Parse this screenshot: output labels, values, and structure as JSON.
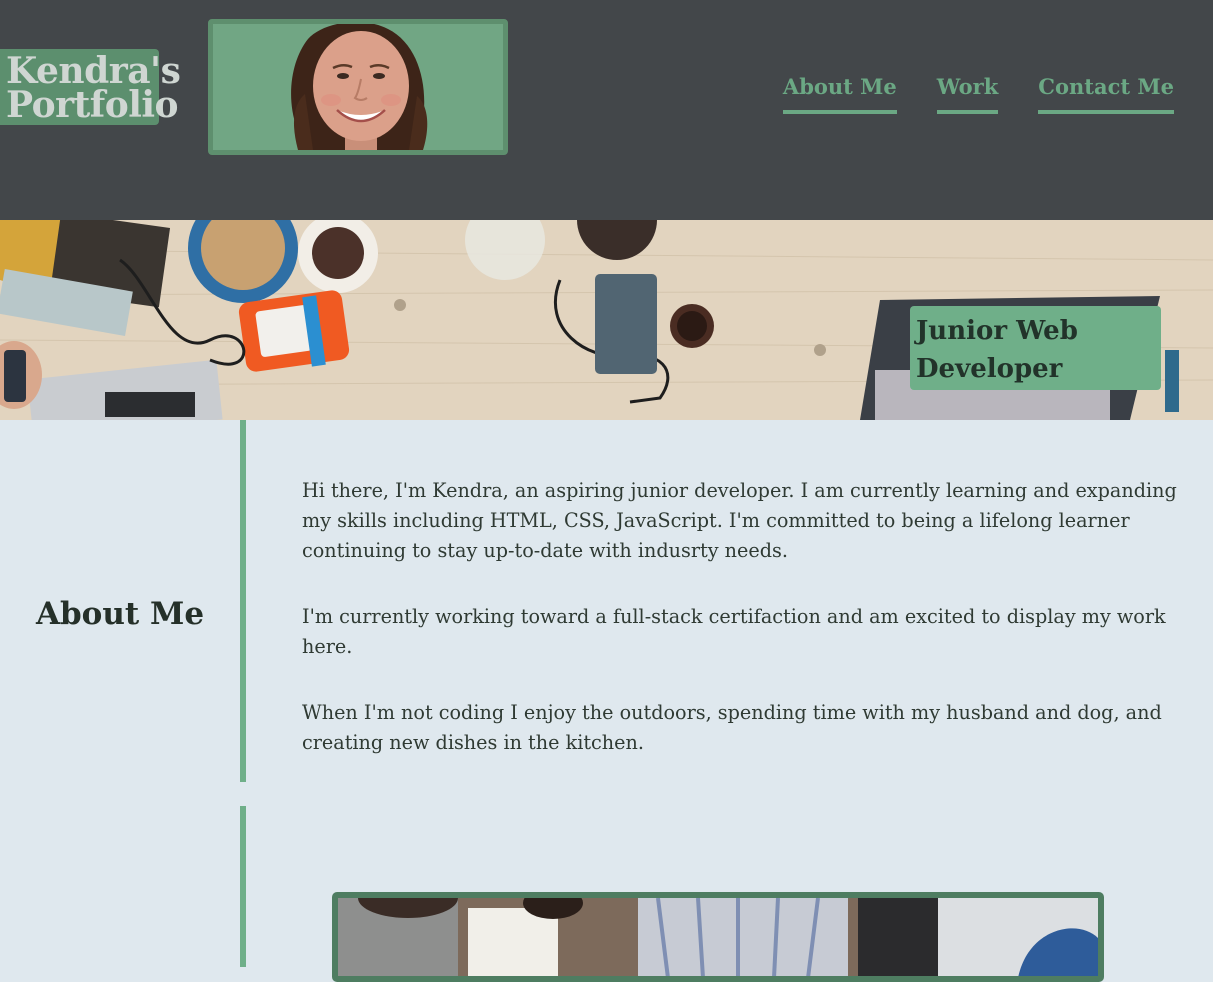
{
  "header": {
    "logo_line1": "Kendra's",
    "logo_line2": "Portfolio",
    "nav": [
      "About Me",
      "Work",
      "Contact Me"
    ]
  },
  "hero": {
    "tagline_line1": "Junior Web",
    "tagline_line2": "Developer"
  },
  "about": {
    "title": "About Me",
    "paragraphs": [
      "Hi there, I'm Kendra, an aspiring junior developer. I am currently learning and expanding my skills including HTML, CSS, JavaScript. I'm committed to being a lifelong learner continuing to stay up-to-date with indusrty needs.",
      "I'm currently working toward a full-stack certifaction and am excited to display my work here.",
      "When I'm not coding I enjoy the outdoors, spending time with my husband and dog, and creating new dishes in the kitchen."
    ]
  },
  "colors": {
    "header_bg": "#43474a",
    "accent": "#6faf89",
    "logo_bg": "#5c8f6e",
    "page_bg": "#dfe8ee"
  }
}
